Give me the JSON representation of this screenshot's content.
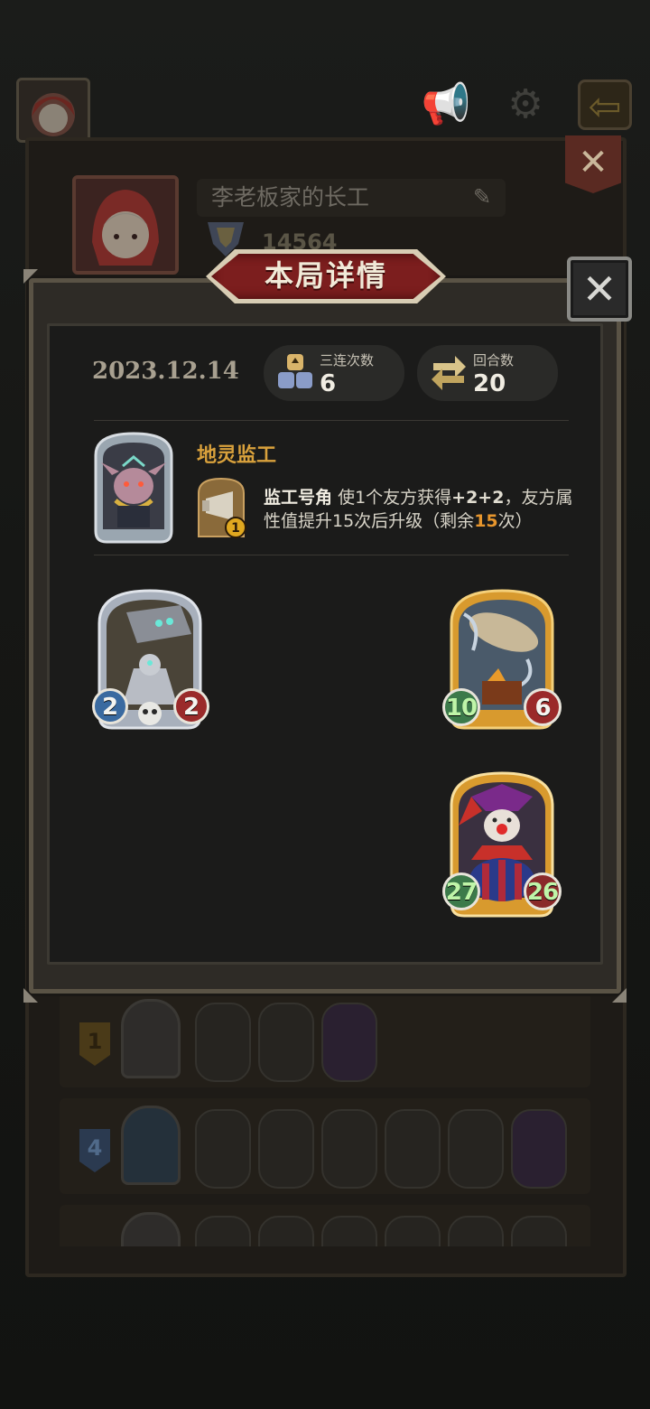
{
  "profile": {
    "name": "李老板家的长工",
    "score": "14564"
  },
  "modal": {
    "title": "本局详情",
    "date": "2023.12.14",
    "stats": [
      {
        "label": "三连次数",
        "value": "6",
        "icon": "triple-icon"
      },
      {
        "label": "回合数",
        "value": "20",
        "icon": "turns-icon"
      }
    ],
    "hero": {
      "name": "地灵监工",
      "skill_name": "监工号角",
      "skill_desc_1": "使1个友方获得",
      "skill_buff": "+2+2",
      "skill_desc_2": "，友方属性值提升15次后升级（剩余",
      "skill_remaining": "15",
      "skill_desc_3": "次）",
      "skill_level": "1"
    },
    "cards": [
      {
        "name": "robot-bell-card",
        "attack": "2",
        "health": "2",
        "golden": false
      },
      {
        "name": "airship-card",
        "attack": "10",
        "health": "6",
        "golden": true
      },
      {
        "name": "clown-card",
        "attack": "27",
        "health": "26",
        "golden": true
      }
    ]
  },
  "history": [
    {
      "rank": "1"
    },
    {
      "rank": "4"
    }
  ],
  "colors": {
    "accent": "#d9a13c",
    "banner": "#7c1e1e",
    "highlight": "#e7962d"
  }
}
